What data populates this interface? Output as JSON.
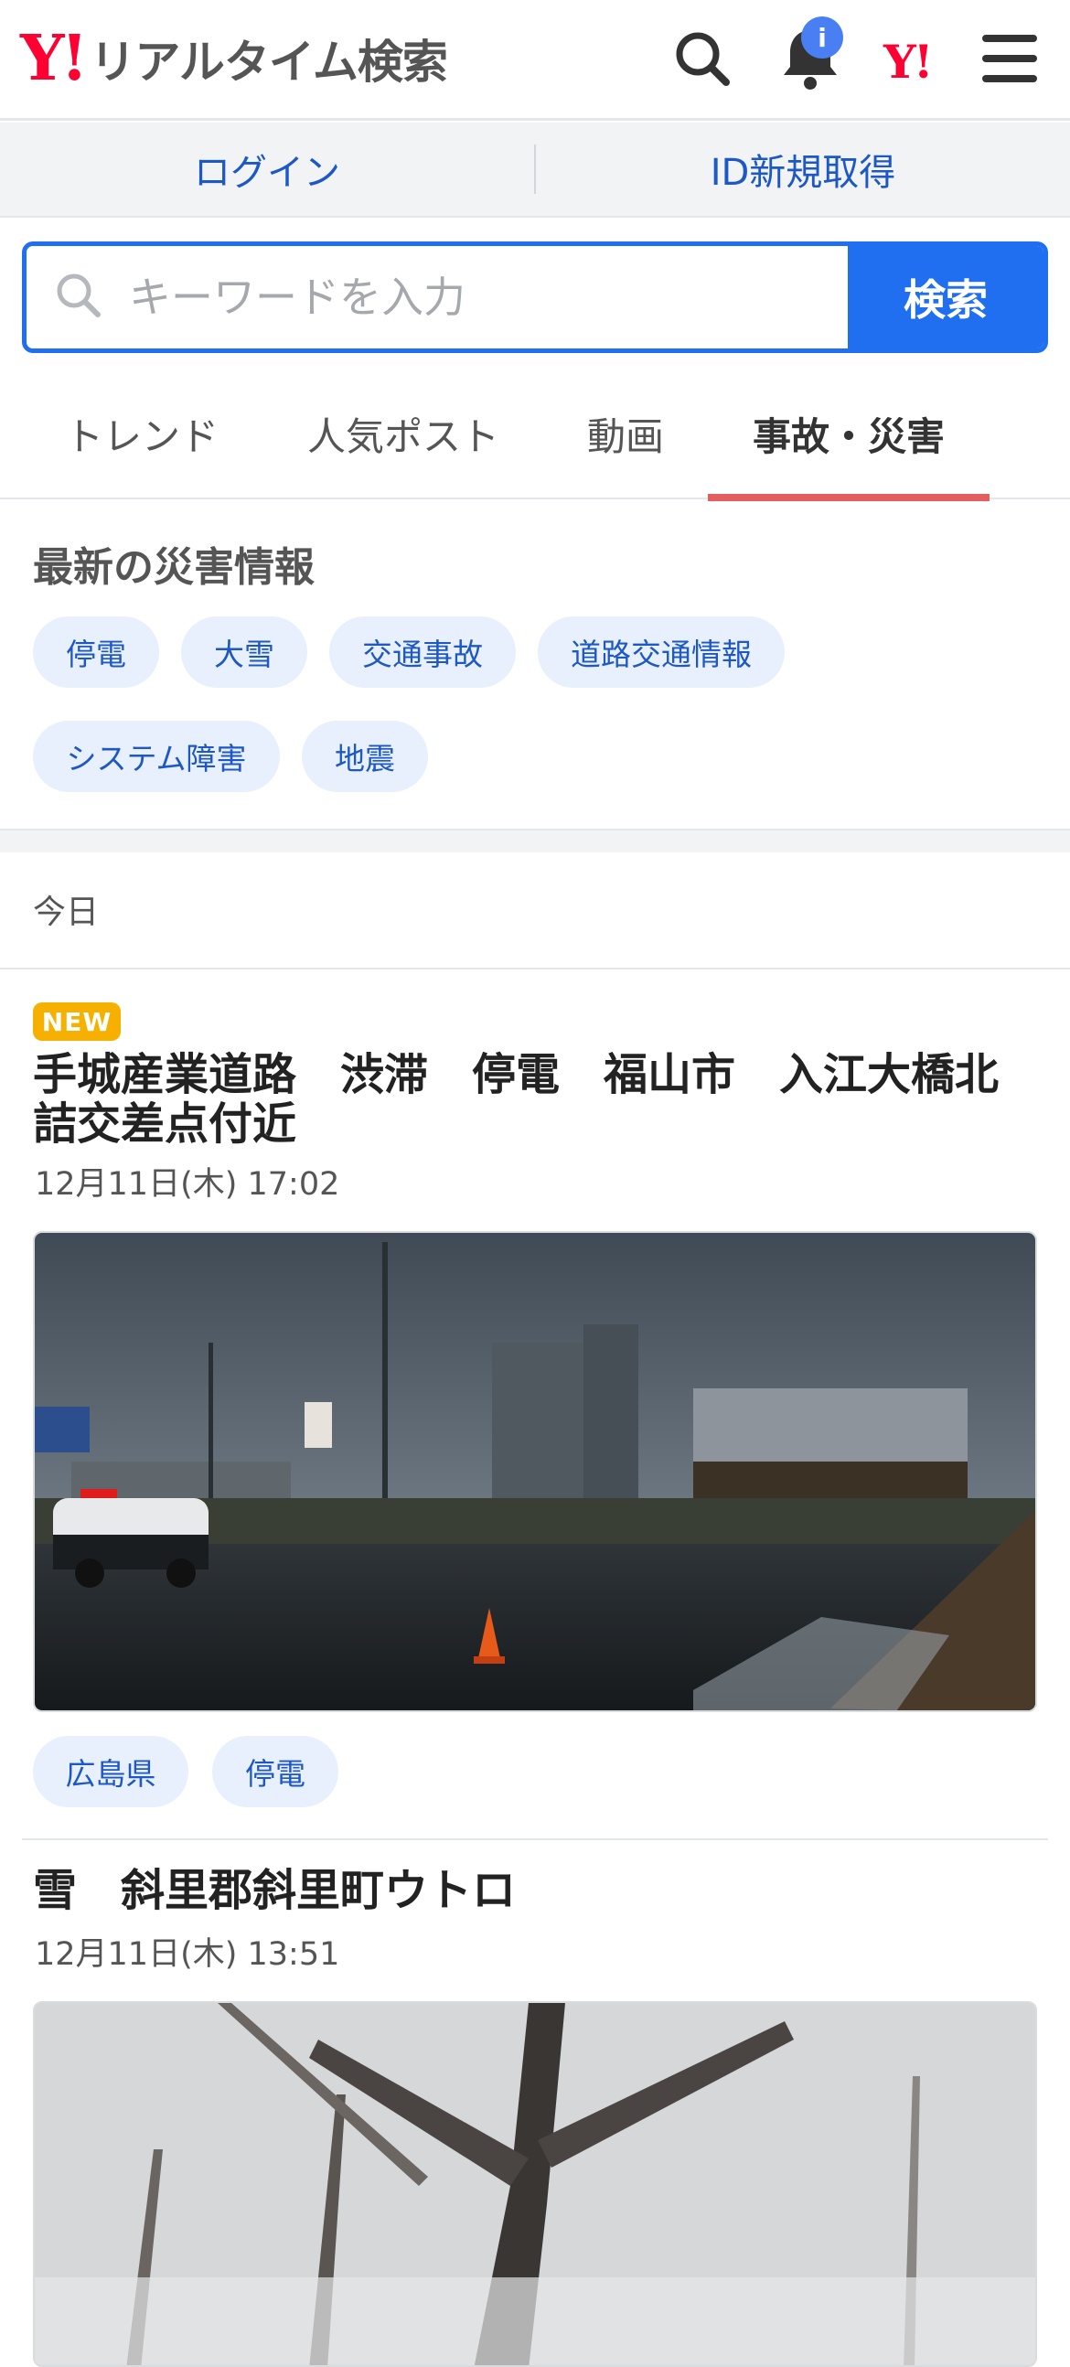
{
  "header": {
    "logo_y": "Y!",
    "logo_text": "リアルタイム検索",
    "notification_badge": "i",
    "yahoo_mini": "Y!"
  },
  "auth": {
    "login": "ログイン",
    "signup": "ID新規取得"
  },
  "search": {
    "placeholder": "キーワードを入力",
    "button": "検索"
  },
  "tabs": [
    {
      "label": "トレンド"
    },
    {
      "label": "人気ポスト"
    },
    {
      "label": "動画"
    },
    {
      "label": "事故・災害",
      "active": true
    }
  ],
  "disaster": {
    "title": "最新の災害情報",
    "chips": [
      "停電",
      "大雪",
      "交通事故",
      "道路交通情報",
      "システム障害",
      "地震"
    ]
  },
  "feed": {
    "date_label": "今日",
    "articles": [
      {
        "badge": "NEW",
        "title": "手城産業道路　渋滞　停電　福山市　入江大橋北詰交差点付近",
        "time": "12月11日(木) 17:02",
        "image": "photo-police-car-rainy-intersection",
        "tags": [
          "広島県",
          "停電"
        ]
      },
      {
        "title": "雪　斜里郡斜里町ウトロ",
        "time": "12月11日(木) 13:51",
        "image": "photo-snowy-trees"
      }
    ]
  },
  "colors": {
    "accent": "#1f6ff0",
    "brand": "#ff0033",
    "tab_indicator": "#e35f5f",
    "badge_new": "#f6b100"
  }
}
